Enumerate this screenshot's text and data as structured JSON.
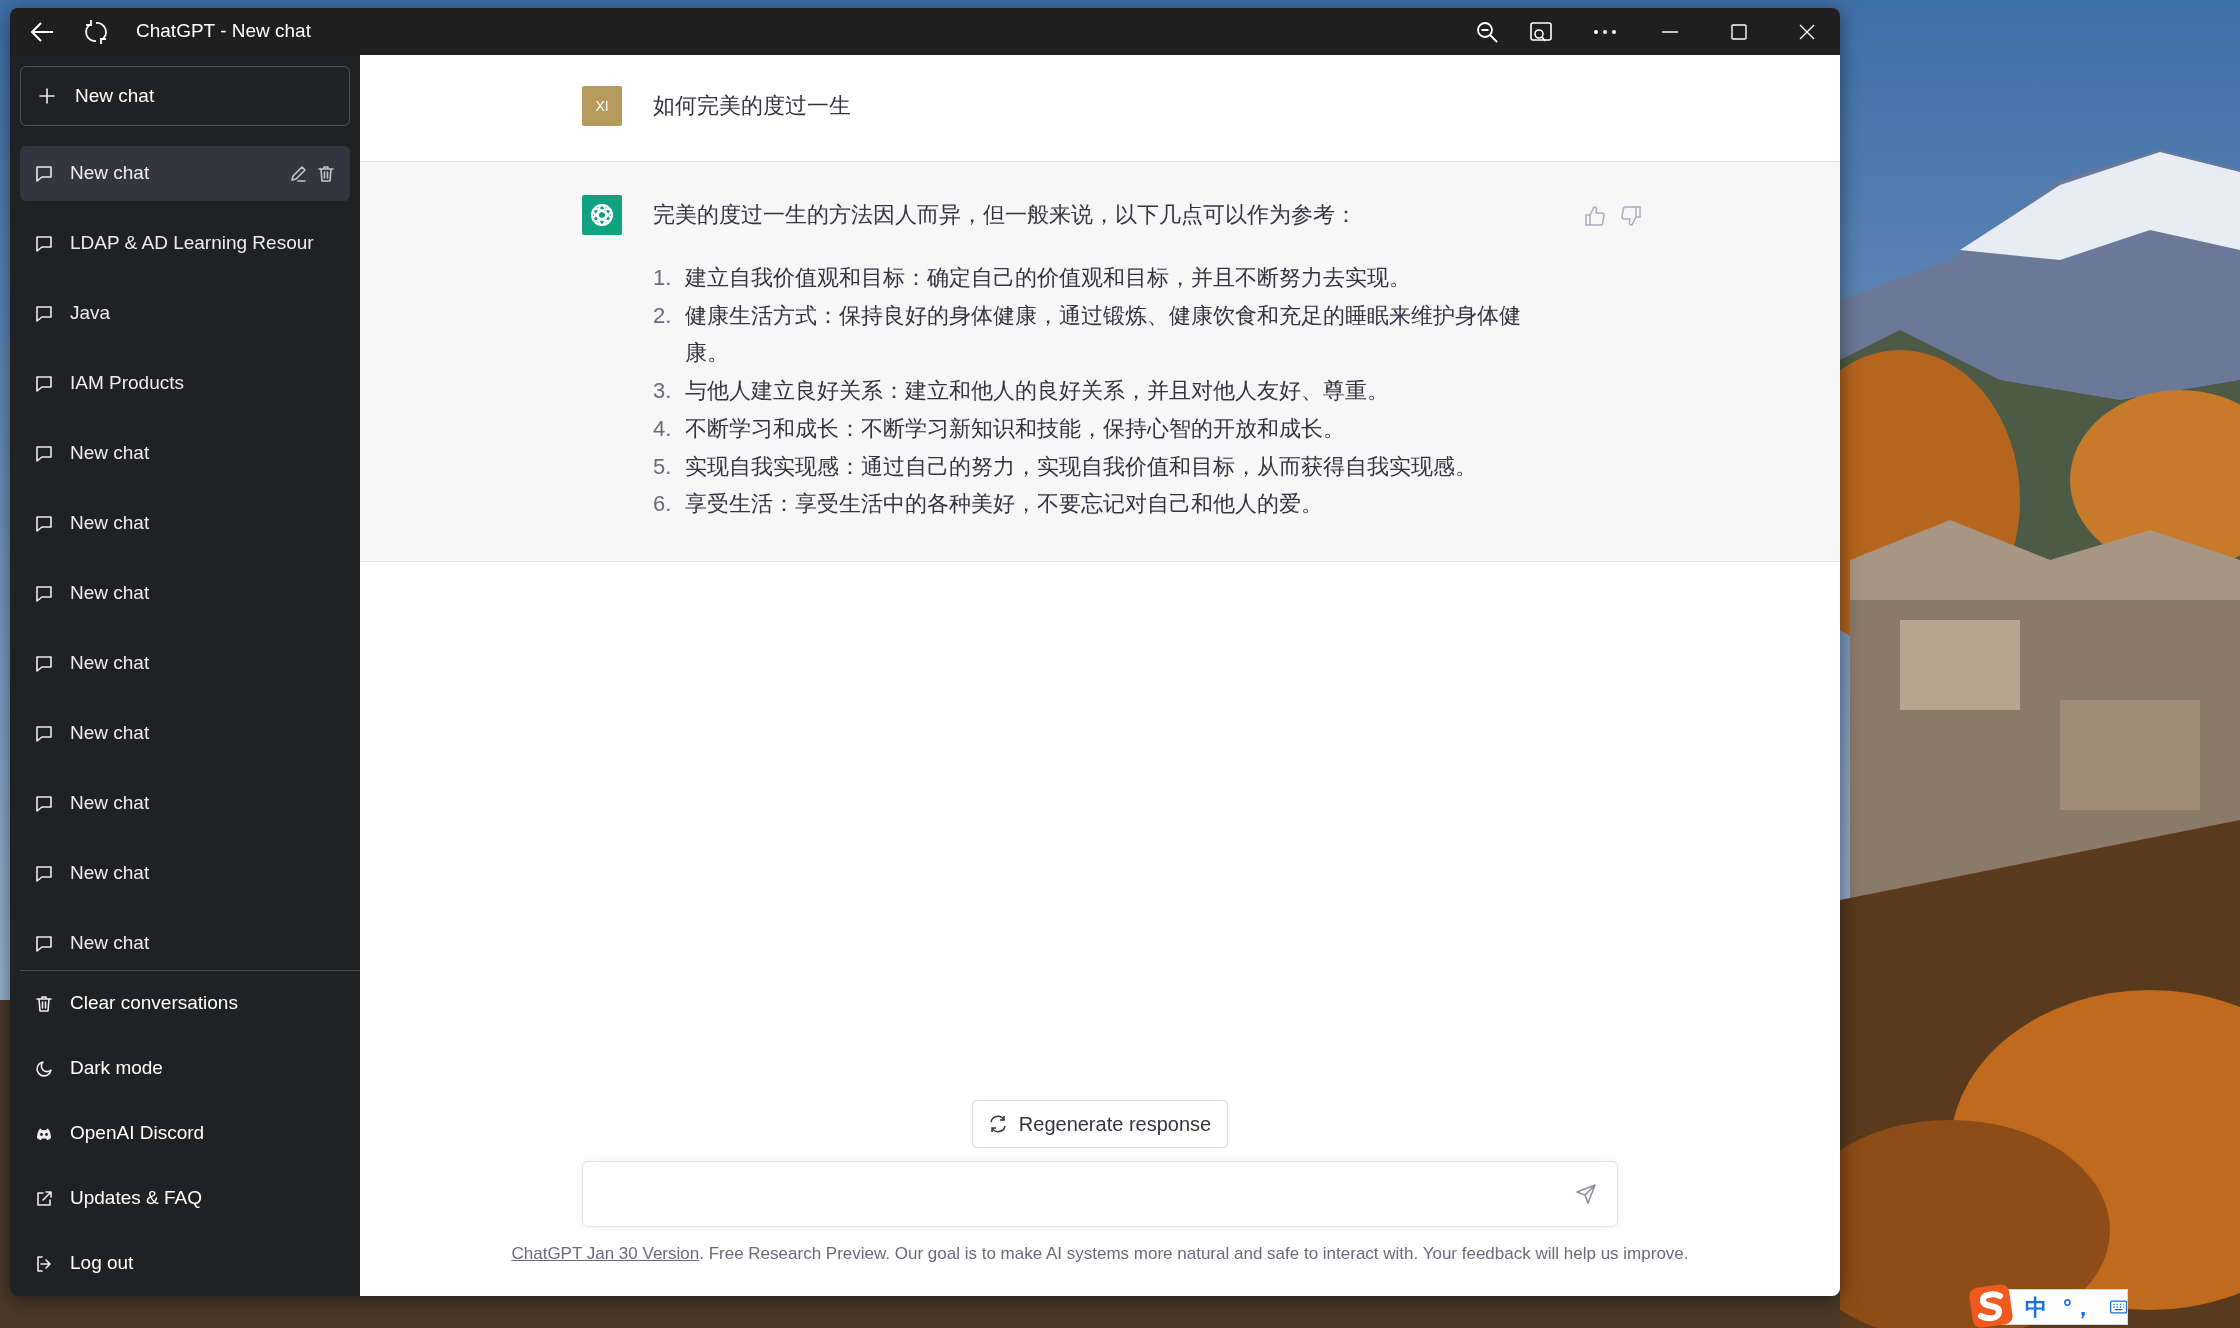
{
  "window": {
    "title": "ChatGPT - New chat"
  },
  "sidebar": {
    "new_chat_button": "New chat",
    "conversations": [
      {
        "title": "New chat",
        "selected": true
      },
      {
        "title": "LDAP & AD Learning Resour",
        "selected": false
      },
      {
        "title": "Java",
        "selected": false
      },
      {
        "title": "IAM Products",
        "selected": false
      },
      {
        "title": "New chat",
        "selected": false
      },
      {
        "title": "New chat",
        "selected": false
      },
      {
        "title": "New chat",
        "selected": false
      },
      {
        "title": "New chat",
        "selected": false
      },
      {
        "title": "New chat",
        "selected": false
      },
      {
        "title": "New chat",
        "selected": false
      },
      {
        "title": "New chat",
        "selected": false
      },
      {
        "title": "New chat",
        "selected": false
      }
    ],
    "footer_items": [
      {
        "label": "Clear conversations",
        "kind": "trash"
      },
      {
        "label": "Dark mode",
        "kind": "moon"
      },
      {
        "label": "OpenAI Discord",
        "kind": "discord"
      },
      {
        "label": "Updates & FAQ",
        "kind": "external"
      },
      {
        "label": "Log out",
        "kind": "logout"
      }
    ]
  },
  "messages": [
    {
      "kind": "user",
      "avatar": "XI",
      "text": "如何完美的度过一生"
    },
    {
      "kind": "assistant",
      "text": "完美的度过一生的方法因人而异，但一般来说，以下几点可以作为参考：",
      "list": [
        {
          "number": "1.",
          "text": "建立自我价值观和目标：确定自己的价值观和目标，并且不断努力去实现。"
        },
        {
          "number": "2.",
          "text": "健康生活方式：保持良好的身体健康，通过锻炼、健康饮食和充足的睡眠来维护身体健康。"
        },
        {
          "number": "3.",
          "text": "与他人建立良好关系：建立和他人的良好关系，并且对他人友好、尊重。"
        },
        {
          "number": "4.",
          "text": "不断学习和成长：不断学习新知识和技能，保持心智的开放和成长。"
        },
        {
          "number": "5.",
          "text": "实现自我实现感：通过自己的努力，实现自我价值和目标，从而获得自我实现感。"
        },
        {
          "number": "6.",
          "text": "享受生活：享受生活中的各种美好，不要忘记对自己和他人的爱。"
        }
      ]
    }
  ],
  "regenerate_button": "Regenerate response",
  "footer": {
    "link": "ChatGPT Jan 30 Version",
    "text": ". Free Research Preview. Our goal is to make AI systems more natural and safe to interact with. Your feedback will help us improve."
  },
  "ime": {
    "mode": "中",
    "punctuation": "°，"
  }
}
